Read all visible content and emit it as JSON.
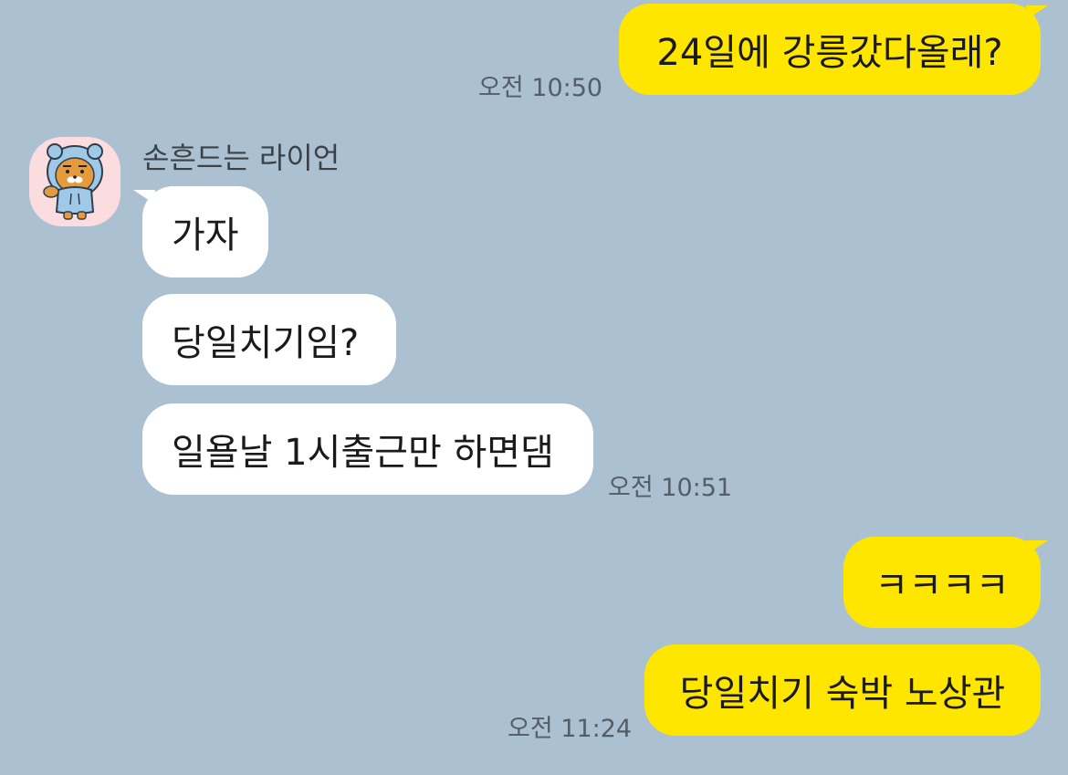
{
  "chat": {
    "messages": [
      {
        "from": "me",
        "text": "24일에 강릉갔다올래?"
      },
      {
        "from": "other",
        "text": "가자"
      },
      {
        "from": "other",
        "text": "당일치기임?"
      },
      {
        "from": "other",
        "text": "일욜날 1시출근만 하면댐"
      },
      {
        "from": "me",
        "text": "ㅋㅋㅋㅋ"
      },
      {
        "from": "me",
        "text": "당일치기 숙박 노상관"
      }
    ],
    "timestamps": {
      "t1": "오전 10:50",
      "t2": "오전 10:51",
      "t3": "오전 11:24"
    },
    "sender": {
      "name": "손흔드는 라이언",
      "avatar_icon": "ryan-character-avatar"
    }
  },
  "colors": {
    "background": "#abc1d1",
    "my_bubble": "#ffe600",
    "other_bubble": "#ffffff",
    "avatar_bg": "#fbdde0"
  }
}
